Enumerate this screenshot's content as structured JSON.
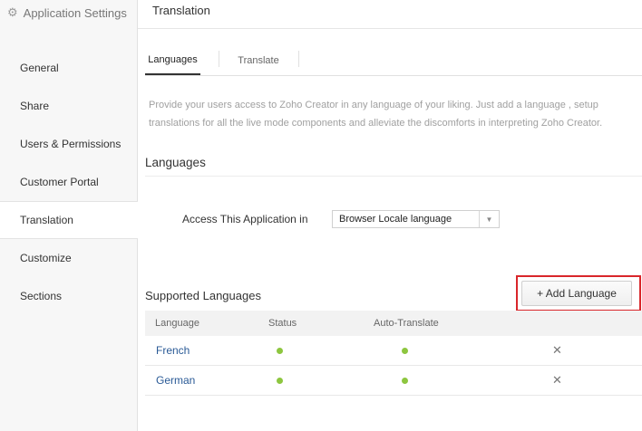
{
  "sidebar": {
    "header": "Application Settings",
    "items": [
      {
        "label": "General",
        "active": false
      },
      {
        "label": "Share",
        "active": false
      },
      {
        "label": "Users & Permissions",
        "active": false
      },
      {
        "label": "Customer Portal",
        "active": false
      },
      {
        "label": "Translation",
        "active": true
      },
      {
        "label": "Customize",
        "active": false
      },
      {
        "label": "Sections",
        "active": false
      }
    ]
  },
  "header": {
    "title": "Translation"
  },
  "tabs": [
    {
      "label": "Languages",
      "active": true
    },
    {
      "label": "Translate",
      "active": false
    }
  ],
  "description": "Provide your users access to Zoho Creator in any language of your liking. Just add a language , setup translations for all the live mode components and alleviate the discomforts in  interpreting Zoho Creator.",
  "languages_section": {
    "title": "Languages",
    "access_label": "Access This Application in",
    "access_value": "Browser Locale language"
  },
  "supported_section": {
    "title": "Supported Languages",
    "add_button": "+ Add Language",
    "columns": [
      "Language",
      "Status",
      "Auto-Translate"
    ],
    "rows": [
      {
        "language": "French",
        "status": "active",
        "auto_translate": "active"
      },
      {
        "language": "German",
        "status": "active",
        "auto_translate": "active"
      }
    ]
  },
  "colors": {
    "accent_dot": "#8dc63f",
    "highlight": "#d9262b",
    "link": "#2a5a96"
  }
}
